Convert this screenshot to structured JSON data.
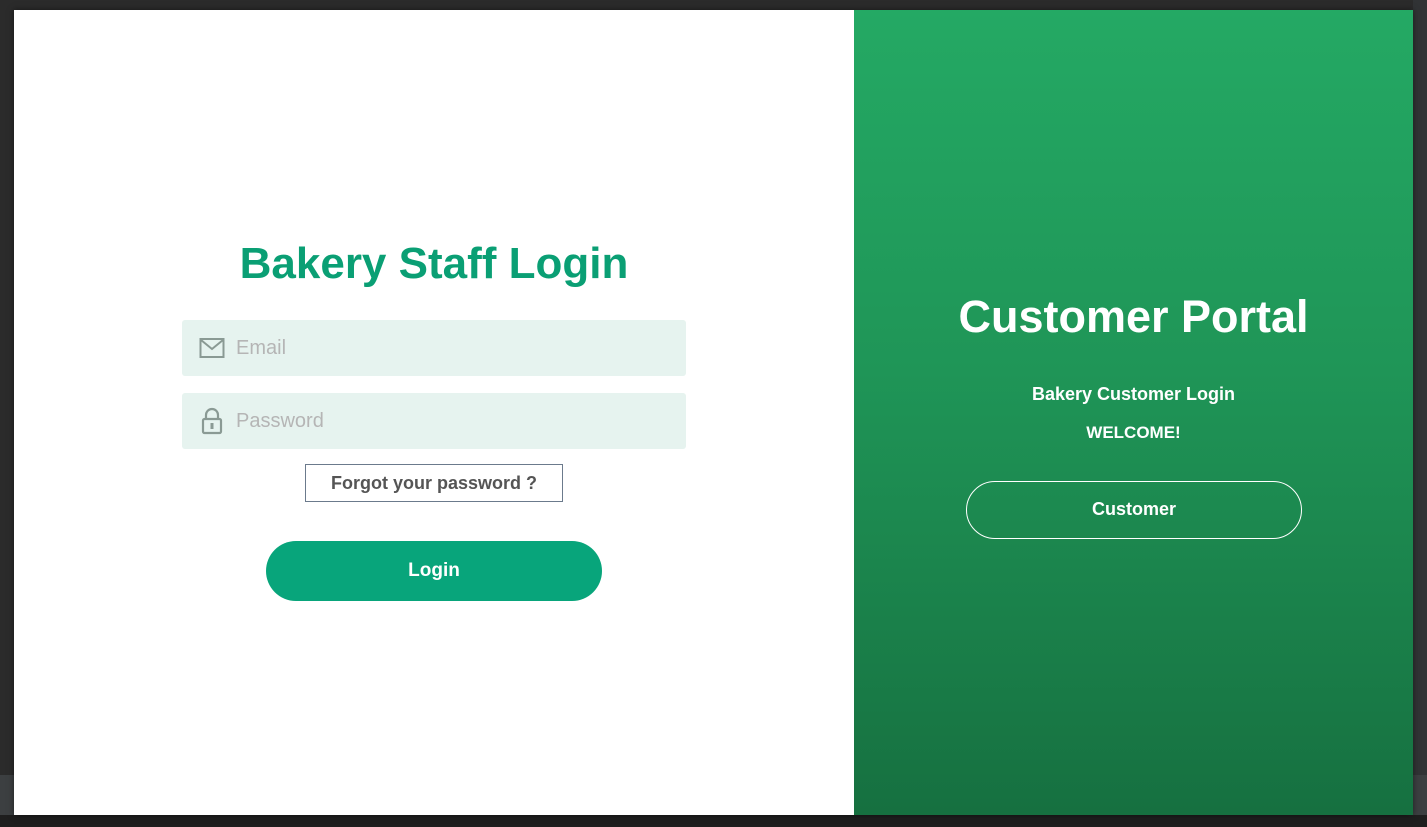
{
  "staff_login": {
    "title": "Bakery Staff Login",
    "email": {
      "placeholder": "Email",
      "value": "",
      "icon": "envelope-icon"
    },
    "password": {
      "placeholder": "Password",
      "value": "",
      "icon": "lock-icon"
    },
    "forgot_label": "Forgot your password ?",
    "login_label": "Login"
  },
  "customer_portal": {
    "title": "Customer Portal",
    "subtitle": "Bakery Customer Login",
    "welcome": "WELCOME!",
    "button_label": "Customer"
  },
  "colors": {
    "accent": "#08a57b",
    "title_green": "#0a9f74",
    "field_bg": "#e6f3ef",
    "portal_gradient_top": "#24a964",
    "portal_gradient_bottom": "#167040"
  }
}
